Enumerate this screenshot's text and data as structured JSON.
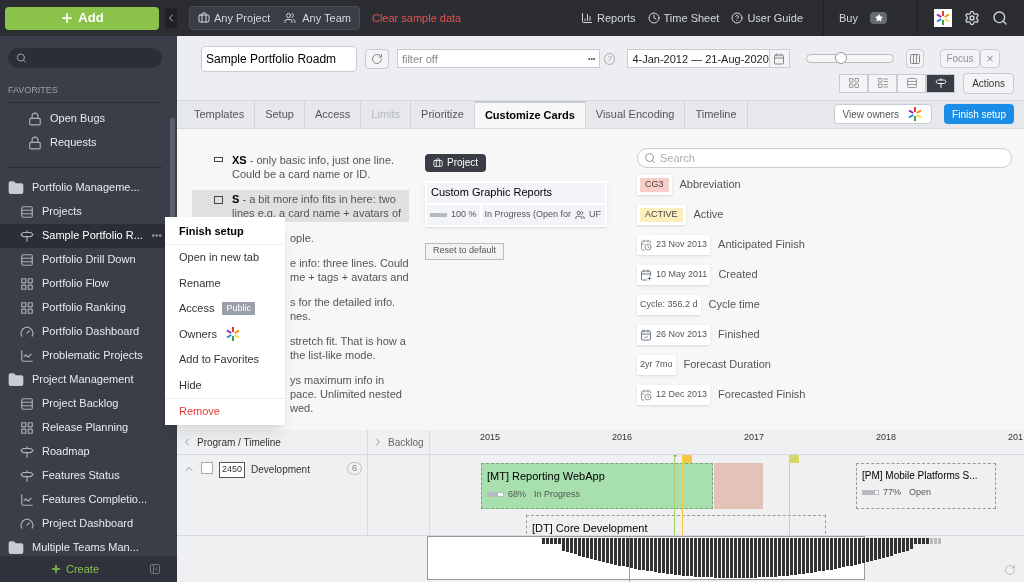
{
  "sidebar": {
    "add_button": "Add",
    "favorites_label": "FAVORITES",
    "item_menu": "•••",
    "favorites": [
      {
        "label": "Open Bugs",
        "kind": "locked",
        "selected": false
      },
      {
        "label": "Requests",
        "kind": "locked",
        "selected": false
      }
    ],
    "groups": [
      {
        "label": "Portfolio Manageme...",
        "children": [
          {
            "label": "Projects",
            "kind": "list",
            "selected": false
          },
          {
            "label": "Sample Portfolio R...",
            "kind": "roadmap",
            "selected": true
          },
          {
            "label": "Portfolio Drill Down",
            "kind": "list",
            "selected": false
          },
          {
            "label": "Portfolio Flow",
            "kind": "board",
            "selected": false
          },
          {
            "label": "Portfolio Ranking",
            "kind": "board",
            "selected": false
          },
          {
            "label": "Portfolio Dashboard",
            "kind": "dashboard",
            "selected": false
          },
          {
            "label": "Problematic Projects",
            "kind": "chart",
            "selected": false
          }
        ]
      },
      {
        "label": "Project  Management",
        "children": [
          {
            "label": "Project Backlog",
            "kind": "list",
            "selected": false
          },
          {
            "label": "Release Planning",
            "kind": "board",
            "selected": false
          },
          {
            "label": "Roadmap",
            "kind": "roadmap",
            "selected": false
          },
          {
            "label": "Features Status",
            "kind": "roadmap",
            "selected": false
          },
          {
            "label": "Features Completio...",
            "kind": "chart",
            "selected": false
          },
          {
            "label": "Project Dashboard",
            "kind": "dashboard",
            "selected": false
          }
        ]
      },
      {
        "label": "Multiple Teams Man..."
      }
    ],
    "create_button": "Create"
  },
  "topbar": {
    "project": "Any Project",
    "team": "Any Team",
    "clear": "Clear sample data",
    "links": [
      {
        "label": "Reports",
        "kind": "reports"
      },
      {
        "label": "Time Sheet",
        "kind": "clock"
      },
      {
        "label": "User Guide",
        "kind": "help"
      }
    ],
    "buy": "Buy"
  },
  "toolbar": {
    "view_name": "Sample Portfolio Roadm",
    "filter": {
      "placeholder": "filter off"
    },
    "more": "•••",
    "help": "?",
    "date_range": "4-Jan-2012 — 21-Aug-2020",
    "zoom": {
      "level": 0.4
    },
    "focus": {
      "label": "Focus",
      "disabled": true
    },
    "clear_focus": {
      "label": "×",
      "disabled": true
    },
    "views": [
      {
        "kind": "board",
        "selected": false
      },
      {
        "kind": "detail",
        "selected": false
      },
      {
        "kind": "list",
        "selected": false
      },
      {
        "kind": "roadmap",
        "selected": true
      }
    ],
    "actions": "Actions"
  },
  "tabs": [
    {
      "label": "Templates",
      "selected": false,
      "disabled": false
    },
    {
      "label": "Setup",
      "selected": false,
      "disabled": false
    },
    {
      "label": "Access",
      "selected": false,
      "disabled": false
    },
    {
      "label": "Limits",
      "selected": false,
      "disabled": true
    },
    {
      "label": "Prioritize",
      "selected": false,
      "disabled": false
    },
    {
      "label": "Customize Cards",
      "selected": true,
      "disabled": false
    },
    {
      "label": "Visual Encoding",
      "selected": false,
      "disabled": false
    },
    {
      "label": "Timeline",
      "selected": false,
      "disabled": false
    }
  ],
  "view_owners": "View owners",
  "finish_setup": "Finish setup",
  "size_options": [
    {
      "size": "XS",
      "selected": false,
      "lines": [
        "- only basic info, just one line.",
        "Could be a card name or ID."
      ]
    },
    {
      "size": "S",
      "selected": true,
      "lines": [
        "- a bit more info fits in here: two",
        "lines e.g. a card name + avatars of"
      ]
    },
    {
      "selected": false,
      "lines": [
        "ople."
      ]
    },
    {
      "selected": false,
      "lines": [
        "e info: three lines. Could",
        "me + tags + avatars and"
      ]
    },
    {
      "selected": false,
      "lines": [
        "s for the detailed info.",
        "nes."
      ]
    },
    {
      "selected": false,
      "lines": [
        "stretch fit. That is how a",
        "the list-like mode."
      ]
    },
    {
      "selected": false,
      "lines": [
        "ys maximum info in",
        "pace. Unlimited nested",
        "wed."
      ]
    }
  ],
  "card_preview": {
    "type_label": "Project",
    "title": "Custom Graphic Reports",
    "progress": {
      "level": 1,
      "reading": "100 %"
    },
    "state": "In Progress (Open for",
    "owner": "UF",
    "reset": "Reset to default"
  },
  "fields": {
    "search": {
      "placeholder": "Search"
    },
    "items": [
      {
        "kind": "tag",
        "color": "#f6cdc7",
        "value": "CG3",
        "label": "Abbreviation"
      },
      {
        "kind": "tag",
        "color": "#fbefbd",
        "value": "ACTIVE",
        "label": "Active"
      },
      {
        "kind": "planned",
        "value": "23 Nov 2013",
        "label": "Anticipated Finish"
      },
      {
        "kind": "created",
        "value": "10 May 2011",
        "label": "Created"
      },
      {
        "kind": "text",
        "value": "Cycle: 356.2 d",
        "label": "Cycle time"
      },
      {
        "kind": "done",
        "value": "26 Nov 2013",
        "label": "Finished"
      },
      {
        "kind": "text",
        "value": "2yr 7mo",
        "label": "Forecast Duration"
      },
      {
        "kind": "planned",
        "value": "12 Dec 2013",
        "label": "Forecasted Finish"
      }
    ]
  },
  "timeline": {
    "program_header": "Program / Timeline",
    "backlog_header": "Backlog",
    "years": [
      "2015",
      "2016",
      "2017",
      "2018",
      "201"
    ],
    "row": {
      "id": "2450",
      "name": "Development",
      "count": "6",
      "checked": false,
      "expanded": true
    },
    "bars": [
      {
        "title": "[MT] Reporting WebApp",
        "progress": {
          "level": 0.68,
          "reading": "68%"
        },
        "state": "In Progress",
        "kind": "active"
      },
      {
        "title": "[PM] Mobile Platforms S...",
        "progress": {
          "level": 0.77,
          "reading": "77%"
        },
        "state": "Open",
        "kind": "outline"
      },
      {
        "title": "[DT] Core Development",
        "kind": "cut"
      }
    ]
  },
  "context_menu": [
    {
      "label": "Finish setup",
      "kind": "primary"
    },
    {
      "label": "Open in new tab",
      "kind": "normal"
    },
    {
      "label": "Rename",
      "kind": "normal"
    },
    {
      "label": "Access",
      "kind": "normal",
      "badge": "Public"
    },
    {
      "label": "Owners",
      "kind": "owners"
    },
    {
      "label": "Add to Favorites",
      "kind": "normal"
    },
    {
      "label": "Hide",
      "kind": "normal"
    },
    {
      "label": "Remove",
      "kind": "danger"
    }
  ]
}
